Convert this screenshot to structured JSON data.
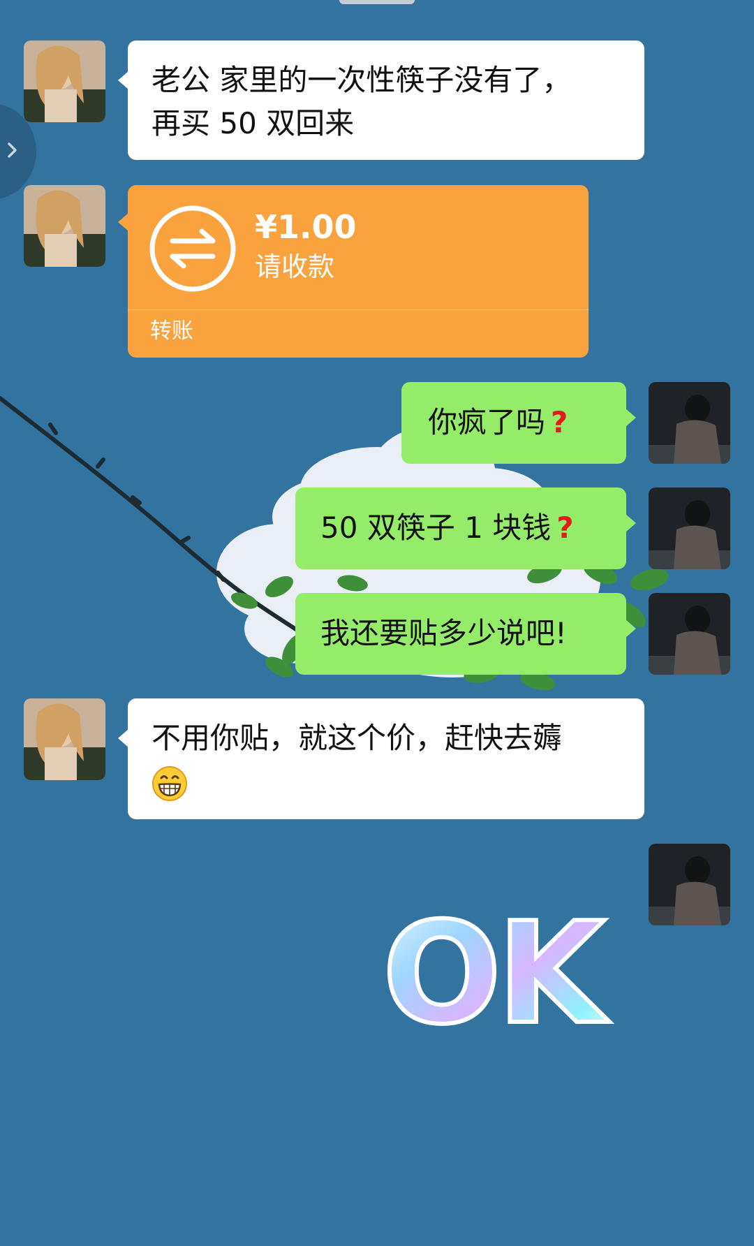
{
  "messages": [
    {
      "side": "left",
      "kind": "text",
      "lines": [
        "老公 家里的一次性筷子没有了，",
        "再买 50 双回来"
      ]
    },
    {
      "side": "left",
      "kind": "transfer",
      "amount": "¥1.00",
      "status": "请收款",
      "type_label": "转账",
      "icon": "transfer-arrows-icon"
    },
    {
      "side": "right",
      "kind": "text",
      "text": "你疯了吗",
      "trailing_icon": "red-question-mark-icon"
    },
    {
      "side": "right",
      "kind": "text",
      "text": "50 双筷子 1 块钱",
      "trailing_icon": "red-question-mark-icon"
    },
    {
      "side": "right",
      "kind": "text",
      "text": "我还要贴多少说吧!"
    },
    {
      "side": "left",
      "kind": "text",
      "lines": [
        "不用你贴，就这个价，赶快去薅"
      ],
      "trailing_icon": "grinning-face-emoji-icon"
    },
    {
      "side": "right",
      "kind": "sticker",
      "sticker_text": "OK"
    }
  ],
  "glyphs": {
    "question_mark": "?"
  },
  "colors": {
    "background": "#33739f",
    "bubble_self": "#95ec69",
    "bubble_other": "#ffffff",
    "transfer_card": "#f9a23e",
    "question_mark": "#e11c1c"
  }
}
